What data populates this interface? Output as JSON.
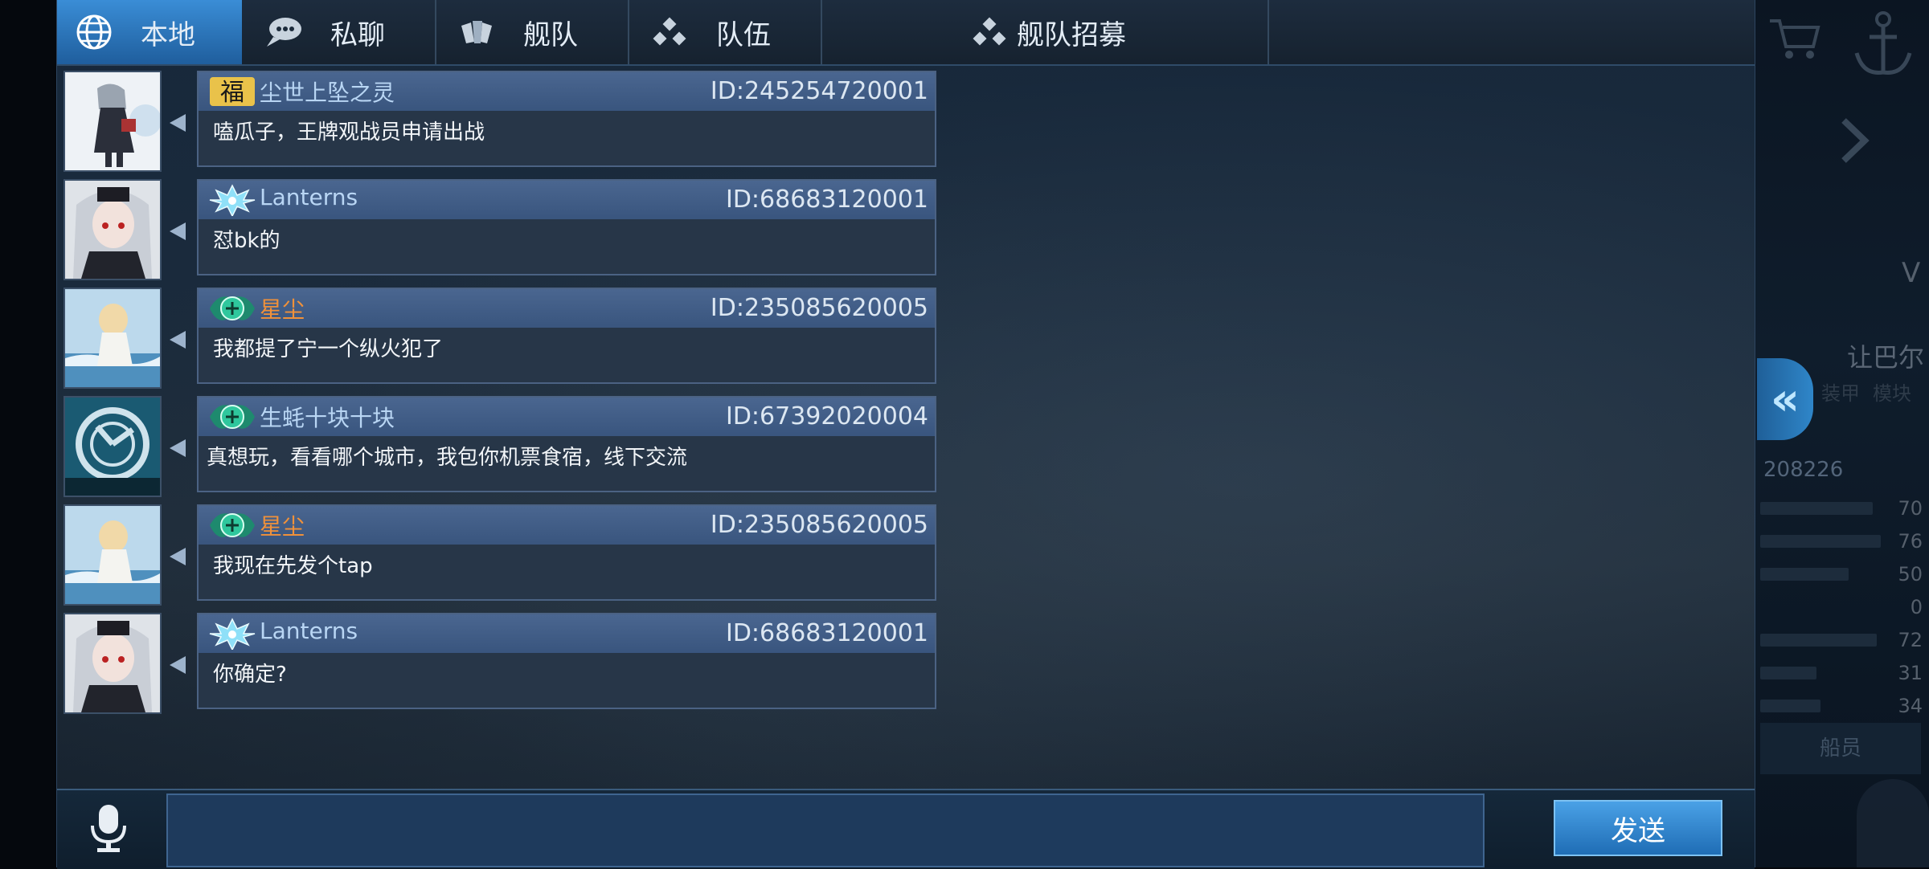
{
  "tabs": [
    {
      "label": "本地",
      "icon": "globe-icon",
      "active": true
    },
    {
      "label": "私聊",
      "icon": "chat-bubble-icon",
      "active": false
    },
    {
      "label": "舰队",
      "icon": "fleet-icon",
      "active": false
    },
    {
      "label": "队伍",
      "icon": "team-dots-icon",
      "active": false
    },
    {
      "label": "舰队招募",
      "icon": "recruit-dots-icon",
      "active": false
    }
  ],
  "messages": [
    {
      "name": "尘世上坠之灵",
      "id": "ID:245254720001",
      "text": "嗑瓜子，王牌观战员申请出战",
      "badge": "fu-badge-icon",
      "name_color": "blue"
    },
    {
      "name": "Lanterns",
      "id": "ID:68683120001",
      "text": "怼bk的",
      "badge": "snowflake-badge-icon",
      "name_color": "blue"
    },
    {
      "name": "星尘",
      "id": "ID:235085620005",
      "text": "我都提了宁一个纵火犯了",
      "badge": "emblem-badge-icon",
      "name_color": "orange"
    },
    {
      "name": "生蚝十块十块",
      "id": "ID:67392020004",
      "text": "真想玩，看看哪个城市，我包你机票食宿，线下交流",
      "badge": "emblem-badge-icon",
      "name_color": "blue"
    },
    {
      "name": "星尘",
      "id": "ID:235085620005",
      "text": "我现在先发个tap",
      "badge": "emblem-badge-icon",
      "name_color": "orange"
    },
    {
      "name": "Lanterns",
      "id": "ID:68683120001",
      "text": "你确定?",
      "badge": "snowflake-badge-icon",
      "name_color": "blue"
    }
  ],
  "input": {
    "value": "",
    "placeholder": ""
  },
  "send_label": "发送",
  "background": {
    "ship_name": "让巴尔",
    "player_id": "208226",
    "armor_label": "装甲",
    "module_label": "模块",
    "crew_label": "船员",
    "stat_values": [
      "70",
      "76",
      "50",
      "0",
      "72",
      "31",
      "34"
    ]
  },
  "colors": {
    "accent": "#2f86c9",
    "orange_name": "#f0913a",
    "blue_name": "#b9d6f4"
  }
}
